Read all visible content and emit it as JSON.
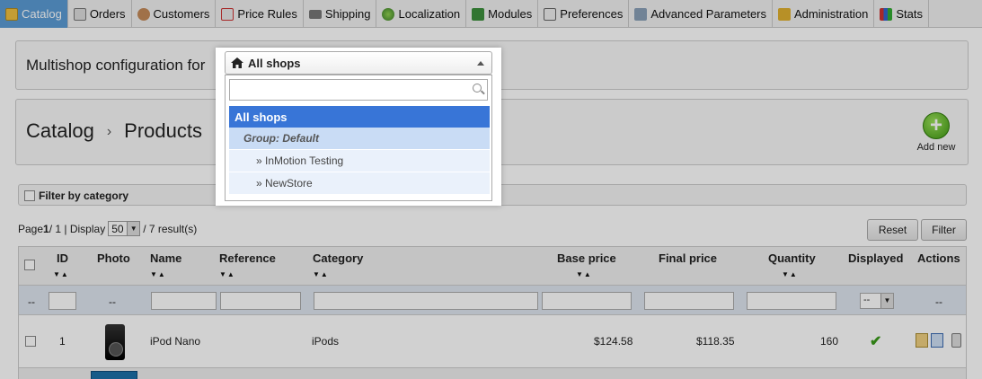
{
  "menu": {
    "tabs": [
      {
        "label": "Catalog",
        "icon": "folder-icon",
        "active": true
      },
      {
        "label": "Orders",
        "icon": "orders-icon"
      },
      {
        "label": "Customers",
        "icon": "customers-icon"
      },
      {
        "label": "Price Rules",
        "icon": "price-rules-icon"
      },
      {
        "label": "Shipping",
        "icon": "truck-icon"
      },
      {
        "label": "Localization",
        "icon": "globe-icon"
      },
      {
        "label": "Modules",
        "icon": "puzzle-icon"
      },
      {
        "label": "Preferences",
        "icon": "preferences-icon"
      },
      {
        "label": "Advanced Parameters",
        "icon": "wrench-icon"
      },
      {
        "label": "Administration",
        "icon": "key-icon"
      },
      {
        "label": "Stats",
        "icon": "bar-chart-icon"
      }
    ]
  },
  "multishop": {
    "label": "Multishop configuration for",
    "selected": "All shops",
    "search_placeholder": "",
    "options": {
      "all": "All shops",
      "group": "Group: Default",
      "shop1": "» InMotion Testing",
      "shop2": "» NewStore"
    }
  },
  "page": {
    "breadcrumb_1": "Catalog",
    "breadcrumb_sep": "›",
    "breadcrumb_2": "Products",
    "add_new_label": "Add new",
    "add_new_glyph": "+"
  },
  "filter": {
    "category_label": "Filter by category"
  },
  "pager": {
    "page_label": "Page",
    "page_current": "1",
    "page_rest": " / 1 | Display",
    "per_page": "50",
    "results": "/ 7 result(s)",
    "reset_label": "Reset",
    "filter_label": "Filter"
  },
  "table": {
    "headers": {
      "id": "ID",
      "photo": "Photo",
      "name": "Name",
      "reference": "Reference",
      "category": "Category",
      "base_price": "Base price",
      "final_price": "Final price",
      "quantity": "Quantity",
      "displayed": "Displayed",
      "actions": "Actions"
    },
    "filter_dash": "--",
    "rows": [
      {
        "id": "1",
        "name": "iPod Nano",
        "reference": "",
        "category": "iPods",
        "base_price": "$124.58",
        "final_price": "$118.35",
        "quantity": "160",
        "displayed_glyph": "✔"
      }
    ]
  },
  "colors": {
    "active_tab": "#5b9bd5",
    "selected_option": "#3875d7",
    "group_option": "#c9dcf5",
    "add_green": "#3f9a12",
    "check_green": "#3a9a1a"
  }
}
